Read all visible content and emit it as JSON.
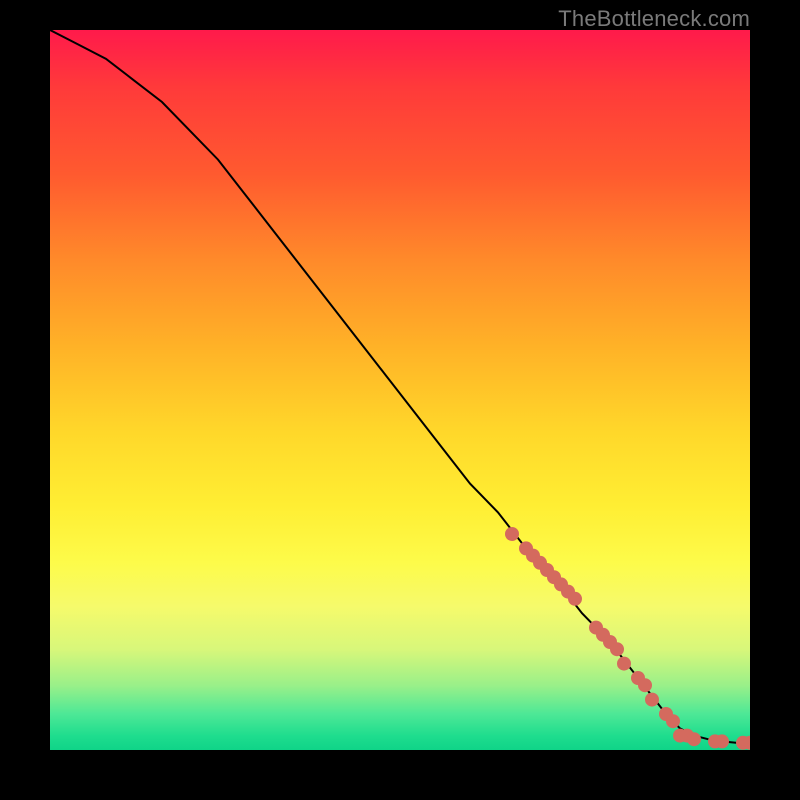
{
  "attribution": "TheBottleneck.com",
  "colors": {
    "curve": "#000000",
    "dots": "#d46a5e",
    "bg_top": "#ff1a4b",
    "bg_bottom": "#0fd488",
    "frame": "#000000"
  },
  "chart_data": {
    "type": "line",
    "title": "",
    "xlabel": "",
    "ylabel": "",
    "xlim": [
      0,
      100
    ],
    "ylim": [
      0,
      100
    ],
    "grid": false,
    "legend": false,
    "series": [
      {
        "name": "curve",
        "x": [
          0,
          4,
          8,
          12,
          16,
          20,
          24,
          28,
          32,
          36,
          40,
          44,
          48,
          52,
          56,
          60,
          64,
          68,
          72,
          76,
          80,
          84,
          88,
          90,
          92,
          94,
          96,
          98,
          100
        ],
        "y": [
          100,
          98,
          96,
          93,
          90,
          86,
          82,
          77,
          72,
          67,
          62,
          57,
          52,
          47,
          42,
          37,
          33,
          28,
          24,
          19,
          15,
          10,
          5,
          3,
          2,
          1.5,
          1.2,
          1.0,
          1.0
        ]
      }
    ],
    "dots": [
      {
        "x": 66,
        "y": 30
      },
      {
        "x": 68,
        "y": 28
      },
      {
        "x": 69,
        "y": 27
      },
      {
        "x": 70,
        "y": 26
      },
      {
        "x": 71,
        "y": 25
      },
      {
        "x": 72,
        "y": 24
      },
      {
        "x": 73,
        "y": 23
      },
      {
        "x": 74,
        "y": 22
      },
      {
        "x": 75,
        "y": 21
      },
      {
        "x": 78,
        "y": 17
      },
      {
        "x": 79,
        "y": 16
      },
      {
        "x": 80,
        "y": 15
      },
      {
        "x": 81,
        "y": 14
      },
      {
        "x": 82,
        "y": 12
      },
      {
        "x": 84,
        "y": 10
      },
      {
        "x": 85,
        "y": 9
      },
      {
        "x": 86,
        "y": 7
      },
      {
        "x": 88,
        "y": 5
      },
      {
        "x": 89,
        "y": 4
      },
      {
        "x": 90,
        "y": 2
      },
      {
        "x": 91,
        "y": 2
      },
      {
        "x": 92,
        "y": 1.5
      },
      {
        "x": 95,
        "y": 1.2
      },
      {
        "x": 96,
        "y": 1.2
      },
      {
        "x": 99,
        "y": 1.0
      },
      {
        "x": 100,
        "y": 1.0
      }
    ]
  }
}
